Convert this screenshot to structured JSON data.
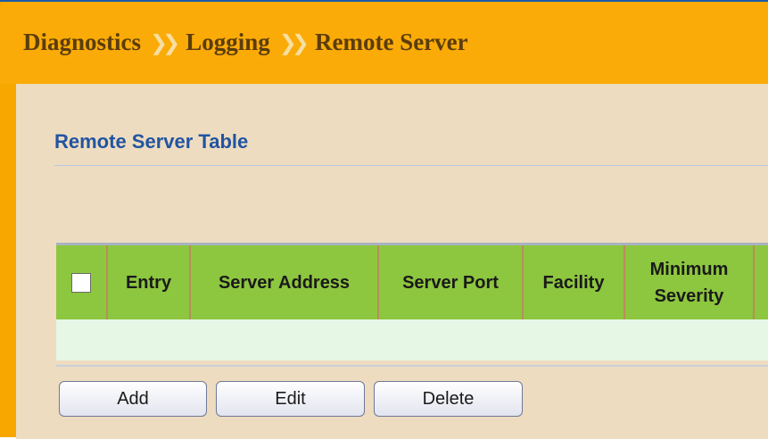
{
  "breadcrumb": {
    "items": [
      "Diagnostics",
      "Logging",
      "Remote Server"
    ],
    "separator": "❯❯"
  },
  "section": {
    "title": "Remote Server Table"
  },
  "table": {
    "columns": [
      "Entry",
      "Server Address",
      "Server Port",
      "Facility",
      "Minimum\nSeverity"
    ],
    "rows": []
  },
  "buttons": {
    "add": "Add",
    "edit": "Edit",
    "delete": "Delete"
  },
  "colors": {
    "title_bar": "#fbab07",
    "breadcrumb_text": "#5b3d0c",
    "content_bg": "#eedcc0",
    "section_title": "#2154a1",
    "table_header": "#8dc63f",
    "table_row": "#e6f7e6"
  }
}
